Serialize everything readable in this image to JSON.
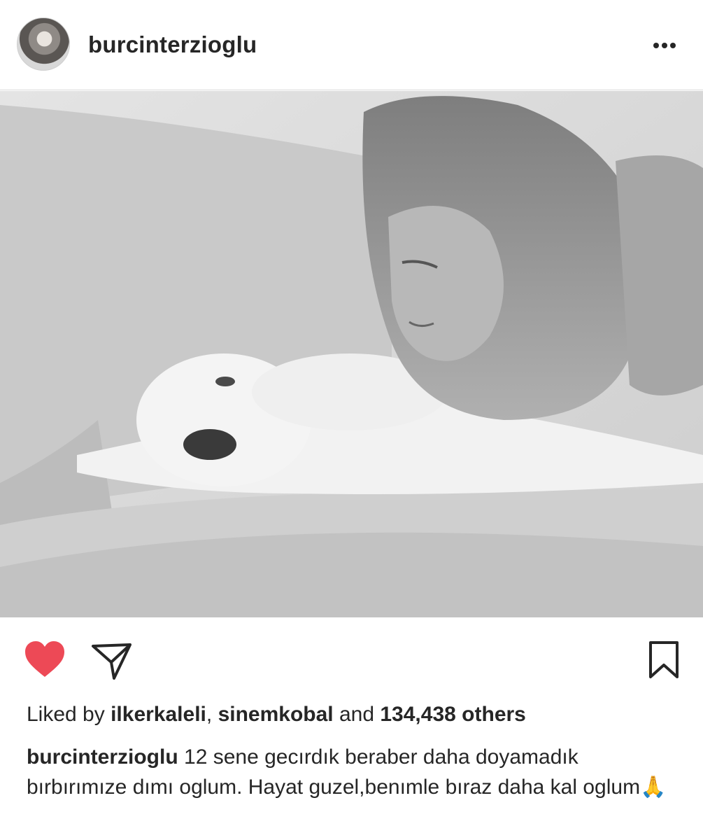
{
  "post": {
    "username": "burcinterzioglu",
    "likes": {
      "prefix": "Liked by",
      "user1": "ilkerkaleli",
      "separator": ",",
      "user2": "sinemkobal",
      "conjunction": "and",
      "others_count": "134,438",
      "others_label": "others"
    },
    "caption": {
      "username": "burcinterzioglu",
      "text": "12 sene gecırdık beraber daha doyamadık bırbırımıze dımı oglum. Hayat guzel,benımle bıraz daha kal oglum🙏"
    },
    "photo_alt": "Black and white photo of a woman lying on a sofa next to a small white dog"
  },
  "icons": {
    "more": "more-options-icon",
    "like": "heart-icon",
    "share": "paper-plane-icon",
    "save": "bookmark-icon"
  },
  "colors": {
    "like_red": "#ed4956",
    "text": "#262626",
    "divider": "#dbdbdb"
  }
}
